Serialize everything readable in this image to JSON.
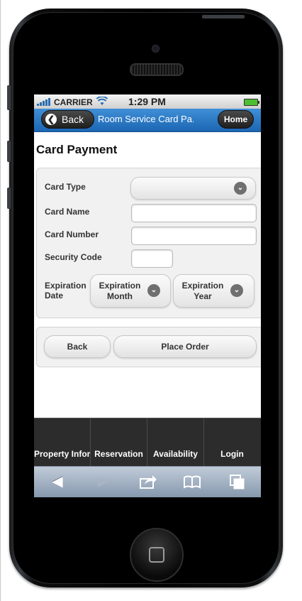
{
  "status_bar": {
    "carrier": "CARRIER",
    "time": "1:29 PM"
  },
  "header": {
    "back_label": "Back",
    "title": "Room Service Card Pa...",
    "home_label": "Home"
  },
  "page": {
    "title": "Card Payment"
  },
  "form": {
    "card_type_label": "Card Type",
    "card_type_value": "",
    "card_name_label": "Card Name",
    "card_name_value": "",
    "card_number_label": "Card Number",
    "card_number_value": "",
    "security_code_label": "Security Code",
    "security_code_value": "",
    "expiration_label_line1": "Expiration",
    "expiration_label_line2": "Date",
    "exp_month_line1": "Expiration",
    "exp_month_line2": "Month",
    "exp_year_line1": "Expiration",
    "exp_year_line2": "Year"
  },
  "actions": {
    "back_label": "Back",
    "place_order_label": "Place Order"
  },
  "navbar": {
    "items": [
      "Property Infor",
      "Reservation",
      "Availability",
      "Login"
    ]
  },
  "browser_toolbar": {
    "icons": [
      "back-arrow-icon",
      "forward-arrow-icon",
      "share-icon",
      "bookmarks-icon",
      "tabs-icon"
    ]
  },
  "colors": {
    "header_blue": "#1c66b3",
    "navbar_dark": "#2c2c2c",
    "battery_green": "#4cbf32"
  }
}
